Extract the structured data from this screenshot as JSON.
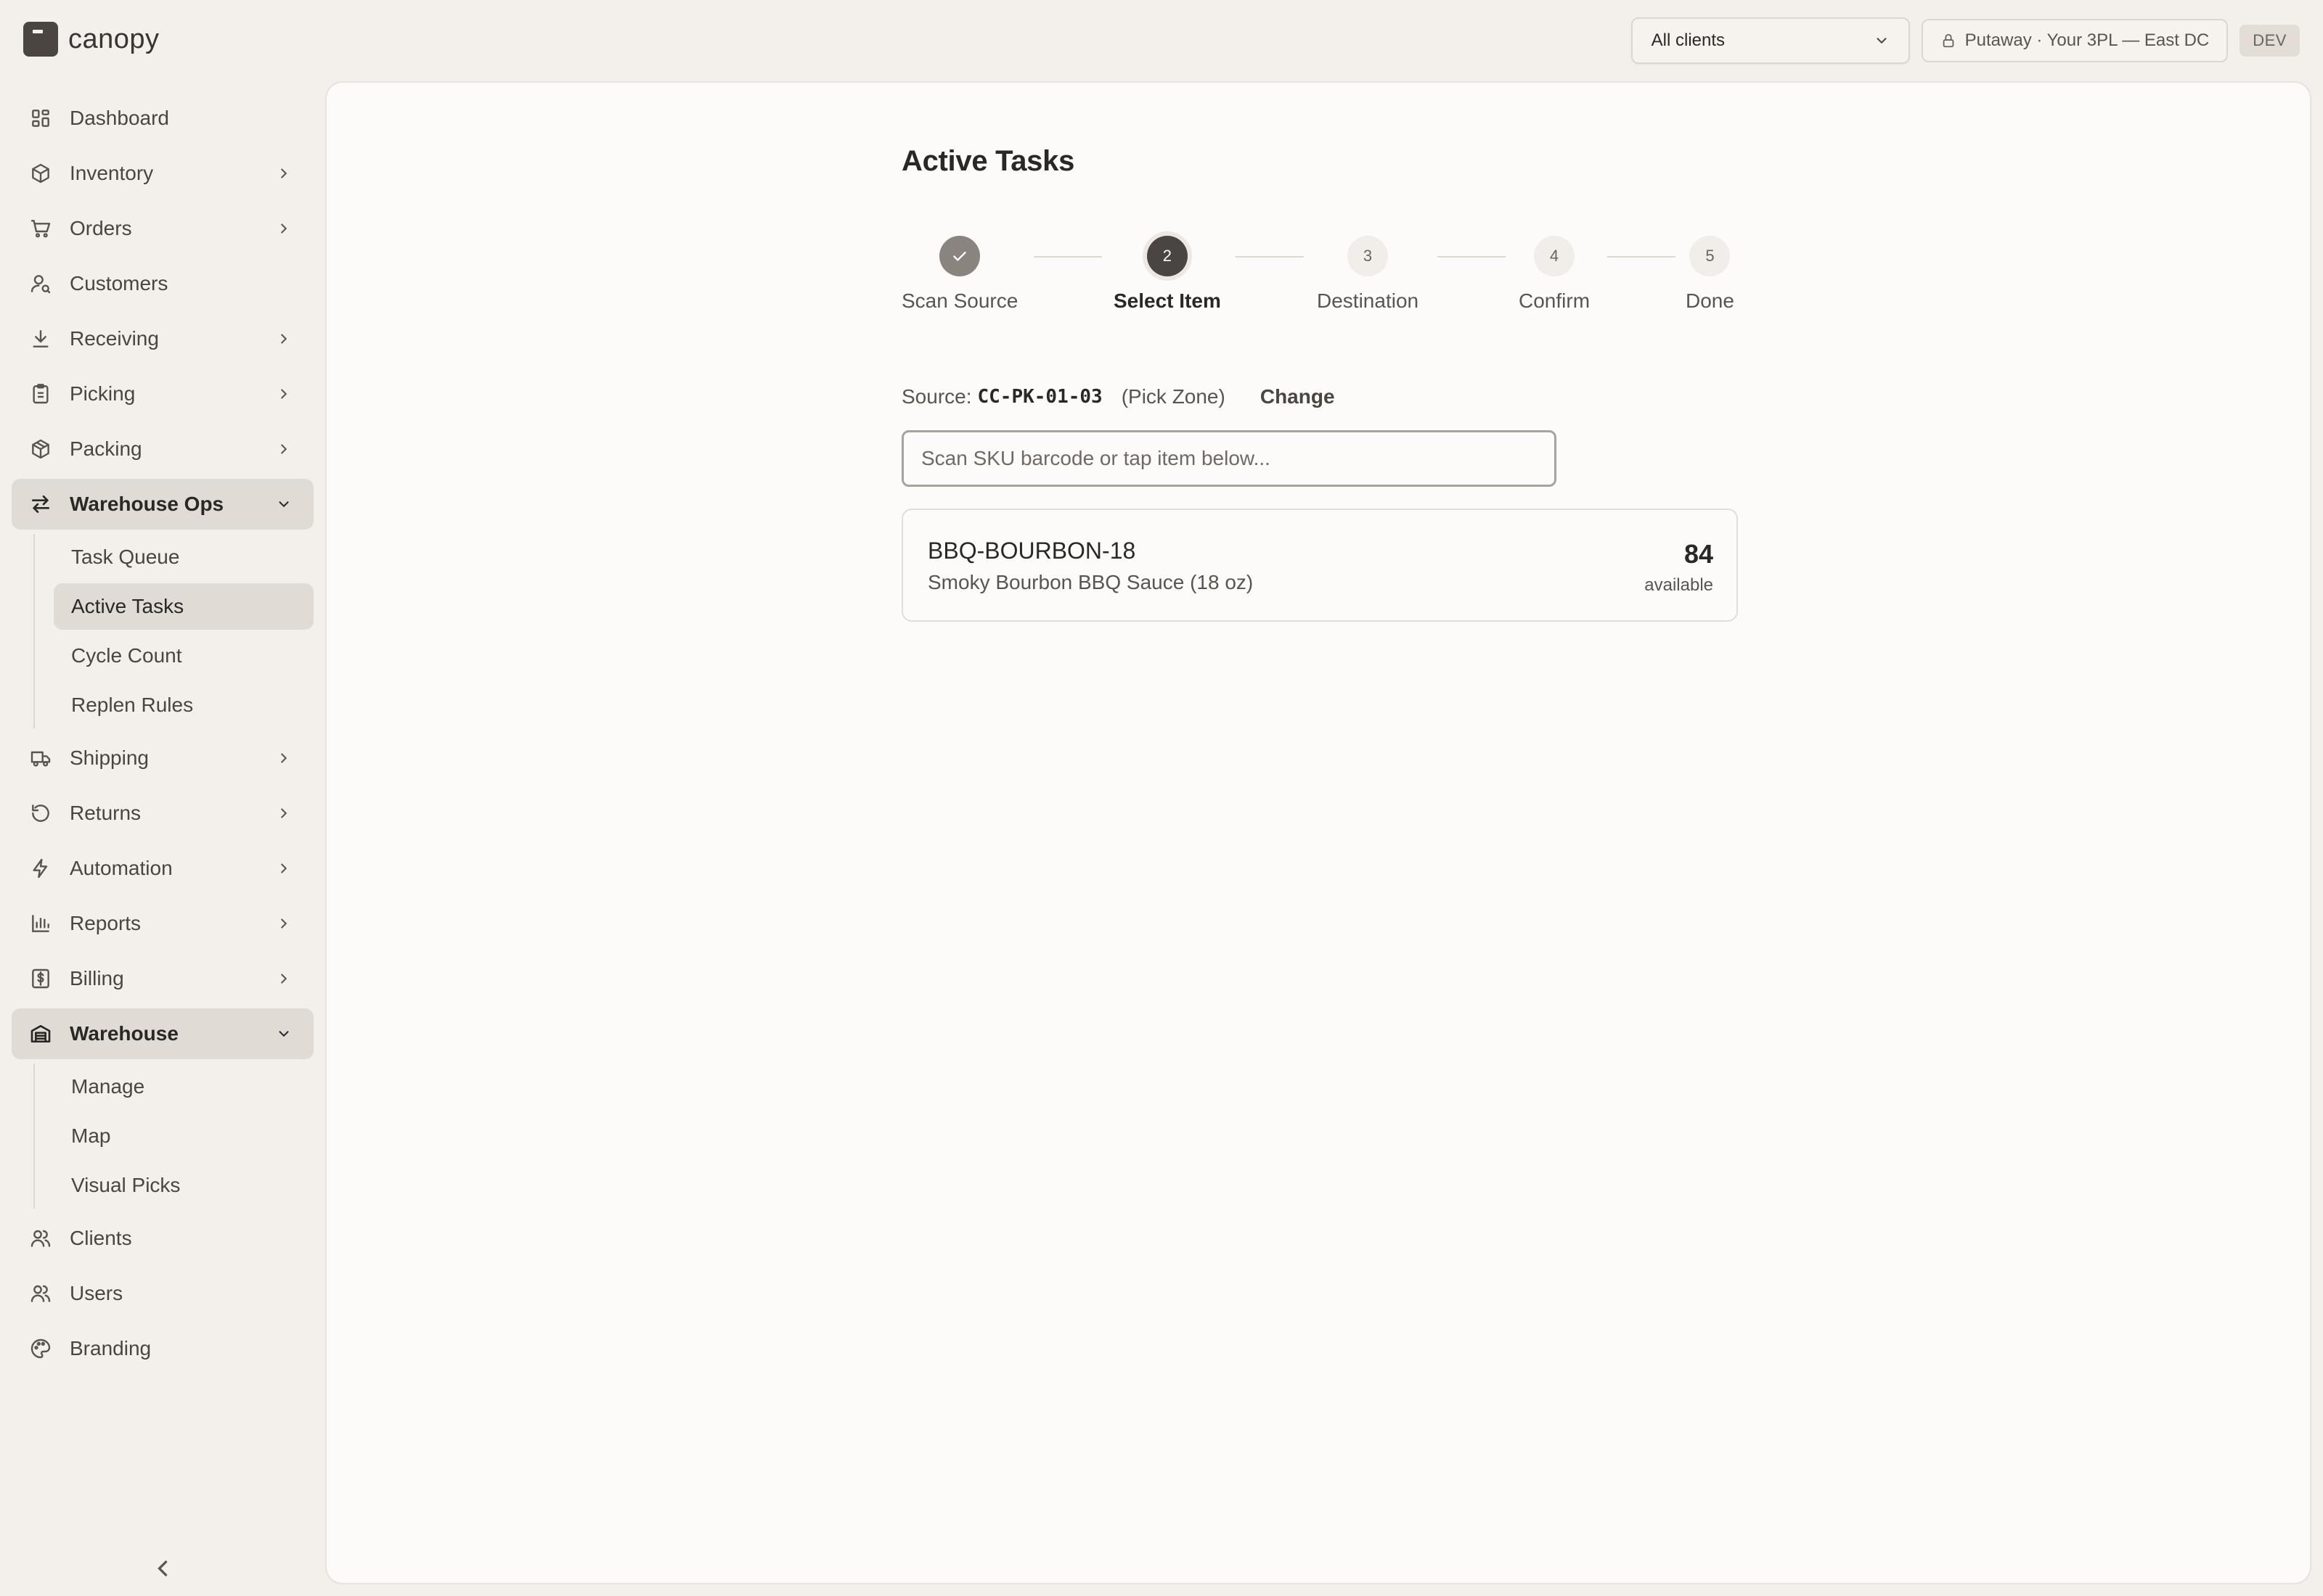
{
  "app": {
    "name": "canopy"
  },
  "topbar": {
    "client_select": {
      "value": "All clients"
    },
    "context": "Putaway · Your 3PL — East DC",
    "env": "DEV"
  },
  "sidebar": {
    "items": [
      {
        "label": "Dashboard",
        "icon": "dashboard-icon"
      },
      {
        "label": "Inventory",
        "icon": "box-icon"
      },
      {
        "label": "Orders",
        "icon": "cart-icon"
      },
      {
        "label": "Customers",
        "icon": "customers-icon"
      },
      {
        "label": "Receiving",
        "icon": "download-icon"
      },
      {
        "label": "Picking",
        "icon": "clipboard-icon"
      },
      {
        "label": "Packing",
        "icon": "package-icon"
      },
      {
        "label": "Warehouse Ops",
        "icon": "swap-arrows-icon"
      },
      {
        "label": "Shipping",
        "icon": "truck-icon"
      },
      {
        "label": "Returns",
        "icon": "rotate-icon"
      },
      {
        "label": "Automation",
        "icon": "bolt-icon"
      },
      {
        "label": "Reports",
        "icon": "bar-chart-icon"
      },
      {
        "label": "Billing",
        "icon": "dollar-receipt-icon"
      },
      {
        "label": "Warehouse",
        "icon": "warehouse-icon"
      },
      {
        "label": "Clients",
        "icon": "clients-icon"
      },
      {
        "label": "Users",
        "icon": "users-icon"
      },
      {
        "label": "Branding",
        "icon": "palette-icon"
      }
    ],
    "warehouse_ops_sub": [
      "Task Queue",
      "Active Tasks",
      "Cycle Count",
      "Replen Rules"
    ],
    "warehouse_sub": [
      "Manage",
      "Map",
      "Visual Picks"
    ],
    "active_sub": "Active Tasks"
  },
  "main": {
    "title": "Active Tasks",
    "steps": [
      {
        "num": "1",
        "label": "Scan Source",
        "state": "done"
      },
      {
        "num": "2",
        "label": "Select Item",
        "state": "current"
      },
      {
        "num": "3",
        "label": "Destination",
        "state": "pending"
      },
      {
        "num": "4",
        "label": "Confirm",
        "state": "pending"
      },
      {
        "num": "5",
        "label": "Done",
        "state": "pending"
      }
    ],
    "source": {
      "label": "Source:",
      "code": "CC-PK-01-03",
      "zone": "(Pick Zone)",
      "change": "Change"
    },
    "scan_input": {
      "value": "",
      "placeholder": "Scan SKU barcode or tap item below..."
    },
    "items": [
      {
        "sku": "BBQ-BOURBON-18",
        "description": "Smoky Bourbon BBQ Sauce (18 oz)",
        "qty": "84",
        "qty_label": "available"
      }
    ]
  },
  "colors": {
    "background": "#f3efea",
    "surface": "#fcfbf9",
    "accent": "#4a4541",
    "active_nav": "#e0dbd5"
  }
}
